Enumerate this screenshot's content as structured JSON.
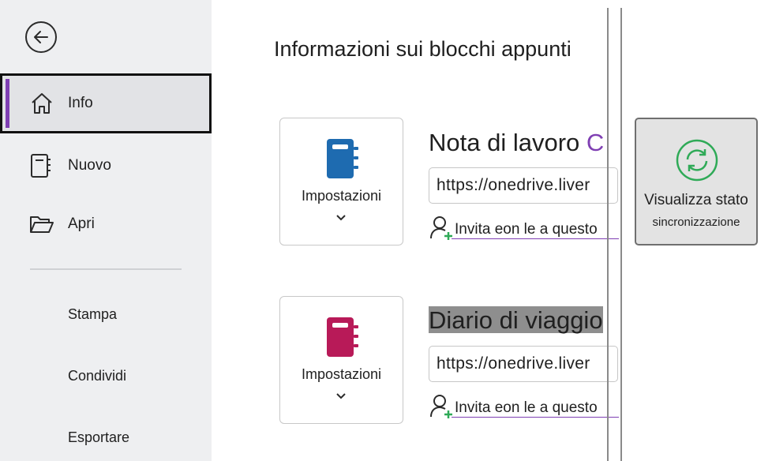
{
  "sidebar": {
    "back_icon": "back-arrow-icon",
    "items": [
      {
        "label": "Info",
        "icon": "home-icon",
        "selected": true
      },
      {
        "label": "Nuovo",
        "icon": "new-notebook-icon"
      },
      {
        "label": "Apri",
        "icon": "folder-open-icon"
      }
    ],
    "sub_items": [
      "Stampa",
      "Condividi",
      "Esportare"
    ]
  },
  "main": {
    "title": "Informazioni sui blocchi appunti",
    "notebooks": [
      {
        "settings_label": "Impostazioni",
        "icon": "notebook-icon",
        "color": "#1e6bb0",
        "title": "Nota di lavoro",
        "title_suffix": "C",
        "url": "https://onedrive.liver",
        "invite": "Invita eon le a questo"
      },
      {
        "settings_label": "Impostazioni",
        "icon": "notebook-icon",
        "color": "#b81a58",
        "title": "Diario di viaggio",
        "url": "https://onedrive.liver",
        "invite": "Invita eon le a questo"
      }
    ],
    "sync": {
      "title": "Visualizza stato",
      "subtitle": "sincronizzazione",
      "icon": "sync-icon",
      "color": "#2faa57"
    }
  },
  "colors": {
    "accent": "#7f3fb3",
    "sidebar_bg": "#eeeff1"
  }
}
